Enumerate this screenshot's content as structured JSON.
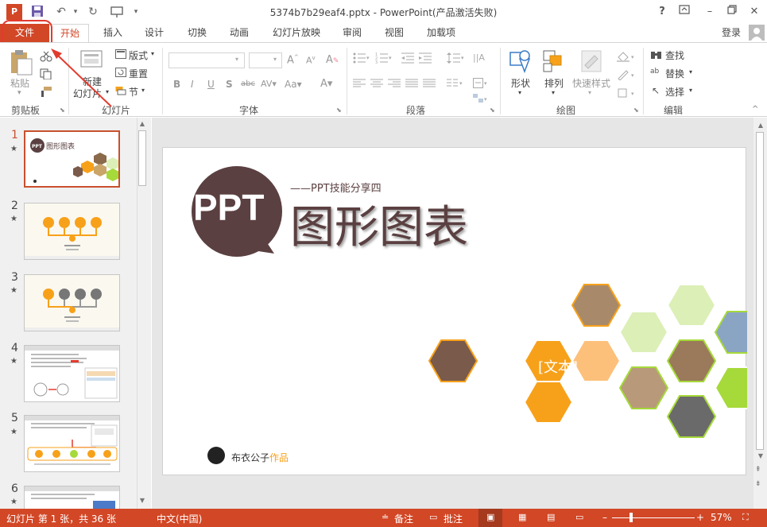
{
  "app": {
    "title": "5374b7b29eaf4.pptx - PowerPoint(产品激活失败)",
    "login": "登录",
    "help": "?"
  },
  "tabs": {
    "file": "文件",
    "items": [
      "开始",
      "插入",
      "设计",
      "切换",
      "动画",
      "幻灯片放映",
      "审阅",
      "视图",
      "加载项"
    ]
  },
  "ribbon": {
    "clipboard": {
      "label": "剪贴板",
      "paste": "粘贴"
    },
    "slides": {
      "label": "幻灯片",
      "new_slide_1": "新建",
      "new_slide_2": "幻灯片",
      "layout": "版式",
      "reset": "重置",
      "section": "节"
    },
    "font": {
      "label": "字体"
    },
    "paragraph": {
      "label": "段落"
    },
    "drawing": {
      "label": "绘图",
      "shape": "形状",
      "arrange": "排列",
      "quick_styles": "快速样式"
    },
    "editing": {
      "label": "编辑",
      "find": "查找",
      "replace": "替换",
      "select": "选择"
    }
  },
  "thumbnails": {
    "numbers": [
      "1",
      "2",
      "3",
      "4",
      "5",
      "6"
    ]
  },
  "slide": {
    "logo_text": "PPT",
    "subtitle": "——PPT技能分享四",
    "title": "图形图表",
    "hex_text": "[文本]",
    "author": "布衣公子",
    "author_suffix": "作品"
  },
  "status": {
    "slide_info": "幻灯片 第 1 张，共 36 张",
    "language": "中文(中国)",
    "notes": "备注",
    "comments": "批注",
    "zoom": "57%"
  },
  "colors": {
    "accent": "#d24726",
    "brand_dark": "#5b4041",
    "orange": "#f7a11a",
    "green": "#a6d93a",
    "light_green": "#dcefb7"
  }
}
